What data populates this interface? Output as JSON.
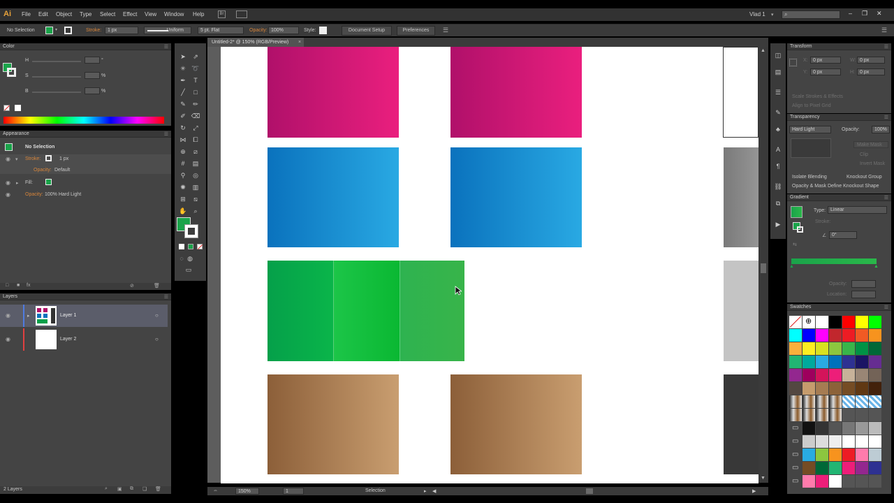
{
  "app": {
    "logo": "Ai",
    "workspace_user": "Vlad 1",
    "search_placeholder": ""
  },
  "menu": [
    "File",
    "Edit",
    "Object",
    "Type",
    "Select",
    "Effect",
    "View",
    "Window",
    "Help"
  ],
  "control_bar": {
    "selection": "No Selection",
    "stroke_label": "Stroke:",
    "stroke_weight": "1 px",
    "stroke_profile": "Uniform",
    "brush": "5 pt. Flat",
    "opacity_label": "Opacity:",
    "opacity_value": "100%",
    "style_label": "Style:",
    "document_setup": "Document Setup",
    "preferences": "Preferences"
  },
  "document_tab": "Untitled-2* @ 150% (RGB/Preview)",
  "color_panel": {
    "title": "Color",
    "labels": [
      "H",
      "S",
      "B"
    ],
    "units": [
      "°",
      "%",
      "%"
    ],
    "fill_color": "#1aa34a"
  },
  "appearance_panel": {
    "title": "Appearance",
    "header": "No Selection",
    "stroke_label": "Stroke:",
    "stroke_value": "1 px",
    "opacity_label": "Opacity:",
    "opacity_value": "Default",
    "fill_label": "Fill:",
    "opacity2_label": "Opacity:",
    "opacity2_value": "100% Hard Light"
  },
  "layers_panel": {
    "title": "Layers",
    "layers": [
      {
        "name": "Layer 1",
        "color": "#4f7be0"
      },
      {
        "name": "Layer 2",
        "color": "#e04040"
      }
    ],
    "footer": "2 Layers"
  },
  "transform_panel": {
    "title": "Transform",
    "x": "X:",
    "y": "Y:",
    "w": "W:",
    "h": "H:",
    "xv": "0 px",
    "yv": "0 px",
    "wv": "0 px",
    "hv": "0 px",
    "scale": "Scale Strokes & Effects",
    "align": "Align to Pixel Grid"
  },
  "transparency_panel": {
    "title": "Transparency",
    "mode": "Hard Light",
    "opacity_label": "Opacity:",
    "opacity_value": "100%",
    "make_mask": "Make Mask",
    "clip": "Clip",
    "invert": "Invert Mask",
    "isolate": "Isolate Blending",
    "knockout": "Knockout Group",
    "opacity_mask": "Opacity & Mask Define Knockout Shape"
  },
  "gradient_panel": {
    "title": "Gradient",
    "type_label": "Type:",
    "type_value": "Linear",
    "stroke_label": "Stroke:",
    "angle": "0°",
    "opacity_label": "Opacity:",
    "location_label": "Location:",
    "ramp_start": "#1aa34a",
    "ramp_end": "#2ab84a"
  },
  "swatches_panel": {
    "title": "Swatches"
  },
  "status_bar": {
    "zoom": "150%",
    "page": "1",
    "tool": "Selection"
  },
  "colors": {
    "magenta_a": "#b0106a",
    "magenta_b": "#ea1f7e",
    "blue_a": "#0a72bd",
    "blue_b": "#29a9e3",
    "green_a": "#05a04a",
    "green_b": "#12c22f",
    "green_c": "#33b14b",
    "tan_a": "#8c5f39",
    "tan_b": "#c99e70",
    "gray_light": "#c4c4c4",
    "gray_mid": "#8a8a8a",
    "gray_dark": "#383838"
  }
}
